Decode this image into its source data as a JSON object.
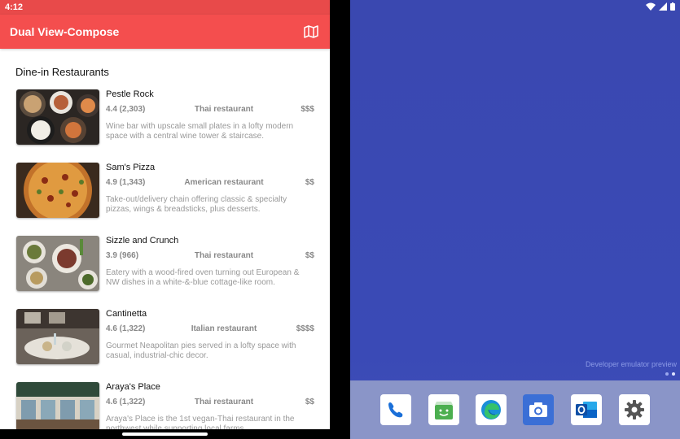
{
  "status_bar": {
    "time": "4:12"
  },
  "app_bar": {
    "title": "Dual View-Compose",
    "map_icon": "map-icon"
  },
  "section": {
    "title": "Dine-in Restaurants"
  },
  "restaurants": [
    {
      "name": "Pestle Rock",
      "rating": "4.4 (2,303)",
      "category": "Thai restaurant",
      "price": "$$$",
      "description": "Wine bar with upscale small plates in a lofty modern space with a central wine tower & staircase."
    },
    {
      "name": "Sam's Pizza",
      "rating": "4.9 (1,343)",
      "category": "American restaurant",
      "price": "$$",
      "description": "Take-out/delivery chain offering classic & specialty pizzas, wings & breadsticks, plus desserts."
    },
    {
      "name": "Sizzle and Crunch",
      "rating": "3.9 (966)",
      "category": "Thai restaurant",
      "price": "$$",
      "description": "Eatery with a wood-fired oven turning out European & NW dishes in a white-&-blue cottage-like room."
    },
    {
      "name": "Cantinetta",
      "rating": "4.6 (1,322)",
      "category": "Italian restaurant",
      "price": "$$$$",
      "description": "Gourmet Neapolitan pies served in a lofty space with casual, industrial-chic decor."
    },
    {
      "name": "Araya's Place",
      "rating": "4.6 (1,322)",
      "category": "Thai restaurant",
      "price": "$$",
      "description": "Araya's Place is the 1st vegan-Thai restaurant in the northwest while supporting local farms."
    }
  ],
  "home": {
    "dev_preview": "Developer emulator preview",
    "dock_apps": [
      "phone-icon",
      "store-icon",
      "edge-icon",
      "camera-icon",
      "outlook-icon",
      "settings-icon"
    ]
  },
  "colors": {
    "accent": "#f44e4e",
    "status": "#e84a4a",
    "home_bg": "#3a48b0",
    "dock": "#8a95c8"
  }
}
